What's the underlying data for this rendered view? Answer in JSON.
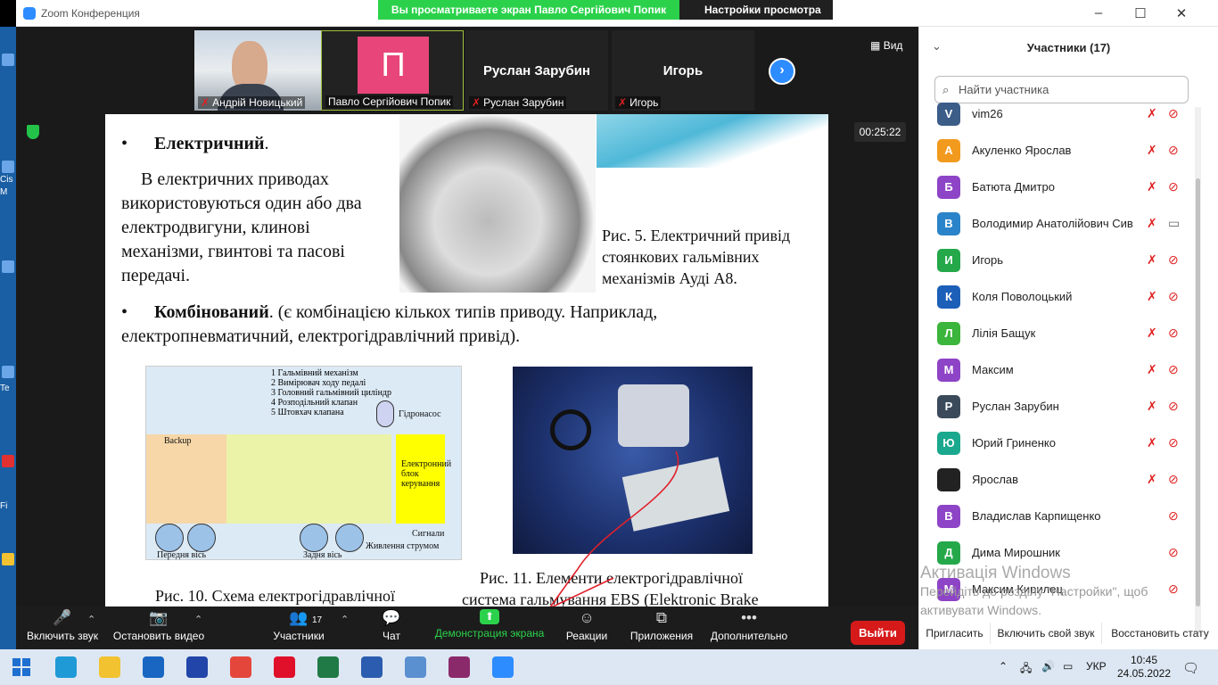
{
  "window": {
    "title": "Zoom Конференция",
    "share_banner": "Вы просматриваете экран Павло Сергійович Попик",
    "view_options": "Настройки просмотра",
    "controls": [
      "–",
      "☐",
      "✕"
    ]
  },
  "desktop_left": {
    "labels": [
      "Cis",
      "M",
      "Te",
      "Fi"
    ]
  },
  "video_strip": {
    "tiles": [
      {
        "name": "Андрій Новицький",
        "muted": true,
        "kind": "video"
      },
      {
        "name": "Павло Сергійович Попик",
        "muted": false,
        "kind": "avatar",
        "letter": "П",
        "color": "#e8467a"
      },
      {
        "name": "Руслан Зарубин",
        "muted": true,
        "kind": "text",
        "big": "Руслан Зарубин"
      },
      {
        "name": "Игорь",
        "muted": true,
        "kind": "text",
        "big": "Игорь"
      }
    ],
    "view_label": "Вид",
    "timer": "00:25:22"
  },
  "slide": {
    "b1_title": "Електричний",
    "b1_dot": ".",
    "b1_body": [
      "В електричних приводах",
      "використовуються один або два",
      "електродвигуни, клинові",
      "механізми, гвинтові та пасові",
      "передачі."
    ],
    "fig5": [
      "Рис. 5. Електричний привід",
      "стоянкових гальмівних",
      "механізмів Ауді А8."
    ],
    "b2_title": "Комбінований",
    "b2_body1": ". (є комбінацією кількох типів приводу. Наприклад,",
    "b2_body2": "електропневматичний, електрогідравлічний привід).",
    "schema_labels": [
      "1 Гальмівний механізм",
      "2 Вимірювач ходу педалі",
      "3 Головний гальмівний циліндр",
      "4 Розподільний клапан",
      "5 Штовхач клапана",
      "Гідронасос",
      "Backup",
      "Електронний блок керування",
      "Передня вісь",
      "Задня вісь",
      "Сигнали",
      "Живлення струмом"
    ],
    "fig10": "Рис. 10. Схема електрогідравлічної",
    "fig11": [
      "Рис. 11. Елементи електрогідравлічної",
      "система гальмування EBS (Elektronic Brake"
    ]
  },
  "toolbar": {
    "items": [
      {
        "label": "Включить звук",
        "icon": "🎤"
      },
      {
        "label": "Остановить видео",
        "icon": "📷"
      },
      {
        "label": "Участники",
        "icon": "👥",
        "count": "17"
      },
      {
        "label": "Чат",
        "icon": "💬"
      },
      {
        "label": "Демонстрация экрана",
        "icon": "⬆"
      },
      {
        "label": "Реакции",
        "icon": "☺"
      },
      {
        "label": "Приложения",
        "icon": "⧉"
      },
      {
        "label": "Дополнительно",
        "icon": "•••"
      }
    ],
    "exit": "Выйти",
    "accent": "#2bd14b"
  },
  "participants": {
    "title": "Участники (17)",
    "search_placeholder": "Найти участника",
    "rows": [
      {
        "letter": "V",
        "name": "vim26",
        "color": "#3b5d88",
        "mic": "muted",
        "cam": "off"
      },
      {
        "letter": "А",
        "name": "Акуленко Ярослав",
        "color": "#f29a1d",
        "mic": "muted",
        "cam": "off"
      },
      {
        "letter": "Б",
        "name": "Батюта Дмитро",
        "color": "#8e44c6",
        "mic": "muted",
        "cam": "off"
      },
      {
        "letter": "В",
        "name": "Володимир Анатолійович Сив...",
        "color": "#2b84c9",
        "mic": "muted",
        "cam": "on"
      },
      {
        "letter": "И",
        "name": "Игорь",
        "color": "#24a84a",
        "mic": "muted",
        "cam": "off"
      },
      {
        "letter": "К",
        "name": "Коля Поволоцький",
        "color": "#1c5fb8",
        "mic": "muted",
        "cam": "off"
      },
      {
        "letter": "Л",
        "name": "Лілія Бащук",
        "color": "#3bb53b",
        "mic": "muted",
        "cam": "off"
      },
      {
        "letter": "М",
        "name": "Максим",
        "color": "#8e44c6",
        "mic": "muted",
        "cam": "off"
      },
      {
        "letter": "Р",
        "name": "Руслан Зарубин",
        "color": "#3a4a5a",
        "mic": "muted",
        "cam": "off"
      },
      {
        "letter": "Ю",
        "name": "Юрий Гриненко",
        "color": "#1aa88e",
        "mic": "muted",
        "cam": "off"
      },
      {
        "letter": "",
        "name": "Ярослав",
        "color": "#222222",
        "mic": "muted",
        "cam": "off"
      },
      {
        "letter": "В",
        "name": "Владислав Карпищенко",
        "color": "#8e44c6",
        "mic": "none",
        "cam": "off"
      },
      {
        "letter": "Д",
        "name": "Дима Мирошник",
        "color": "#24a84a",
        "mic": "none",
        "cam": "off"
      },
      {
        "letter": "М",
        "name": "Максим Кирилец",
        "color": "#8e44c6",
        "mic": "none",
        "cam": "off"
      }
    ],
    "buttons": [
      "Пригласить",
      "Включить свой звук",
      "Восстановить стату"
    ]
  },
  "watermark": {
    "title": "Активація Windows",
    "line1": "Перейдіть до розділу \"Настройки\", щоб",
    "line2": "активувати Windows."
  },
  "taskbar": {
    "lang": "УКР",
    "time": "10:45",
    "date": "24.05.2022",
    "apps": [
      {
        "name": "edge",
        "color": "#1f9ad6"
      },
      {
        "name": "explorer",
        "color": "#f2c230"
      },
      {
        "name": "mail",
        "color": "#1966c2"
      },
      {
        "name": "save",
        "color": "#2145a8"
      },
      {
        "name": "chrome",
        "color": "#e5463b"
      },
      {
        "name": "opera",
        "color": "#e0102a"
      },
      {
        "name": "excel",
        "color": "#1f7a45"
      },
      {
        "name": "word",
        "color": "#2b5caf"
      },
      {
        "name": "search",
        "color": "#5a8fd0"
      },
      {
        "name": "winrar",
        "color": "#8a2a6a"
      },
      {
        "name": "zoom",
        "color": "#2d8cff"
      }
    ]
  }
}
